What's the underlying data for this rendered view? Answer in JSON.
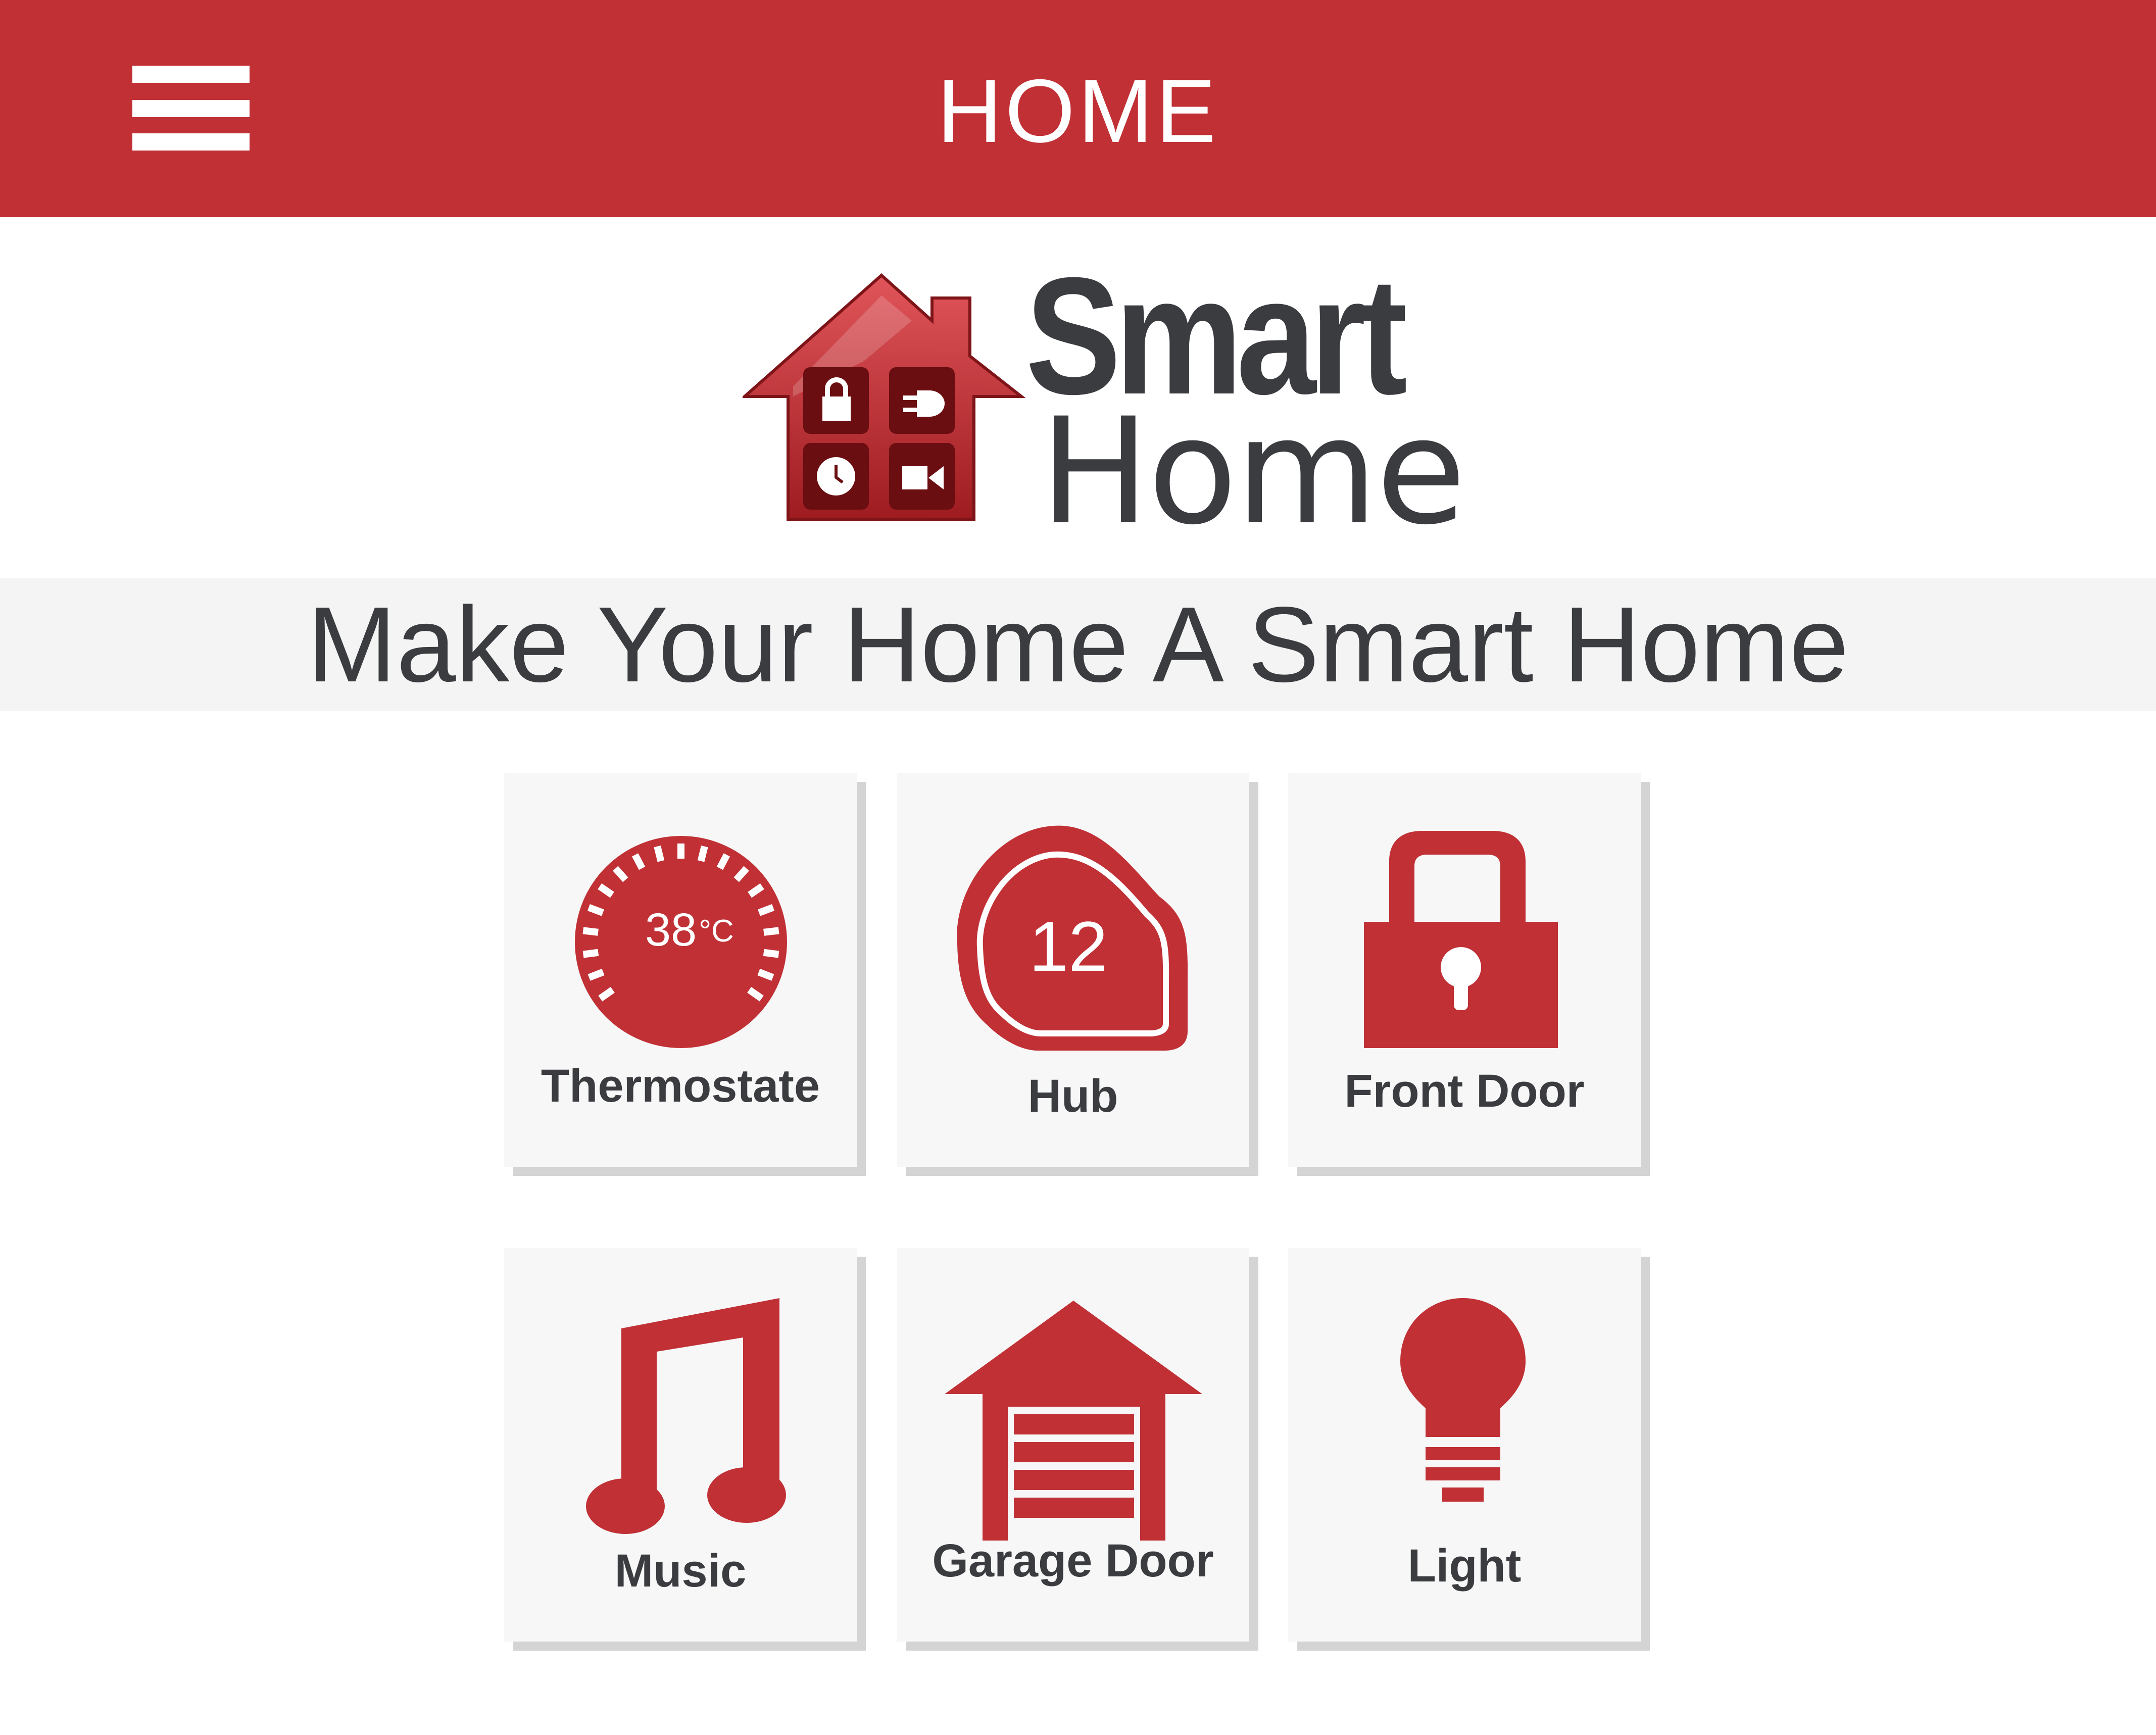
{
  "header": {
    "title": "HOME",
    "menu_icon": "hamburger-menu-icon"
  },
  "logo": {
    "word1": "Smart",
    "word2": "Home",
    "icons": [
      "lock-icon",
      "plug-icon",
      "clock-icon",
      "video-camera-icon"
    ]
  },
  "tagline": "Make Your Home A Smart Home",
  "tiles": [
    {
      "label": "Thermostate",
      "icon": "thermostat-icon",
      "temperature": "38",
      "unit": "°C"
    },
    {
      "label": "Hub",
      "icon": "hub-icon",
      "value": "12"
    },
    {
      "label": "Front Door",
      "icon": "padlock-icon"
    },
    {
      "label": "Music",
      "icon": "music-note-icon"
    },
    {
      "label": "Garage Door",
      "icon": "garage-icon"
    },
    {
      "label": "Light",
      "icon": "light-bulb-icon"
    }
  ],
  "colors": {
    "accent": "#c03035",
    "text": "#3a3c40",
    "tile_bg": "#f7f7f7",
    "shadow": "#d4d4d4"
  }
}
